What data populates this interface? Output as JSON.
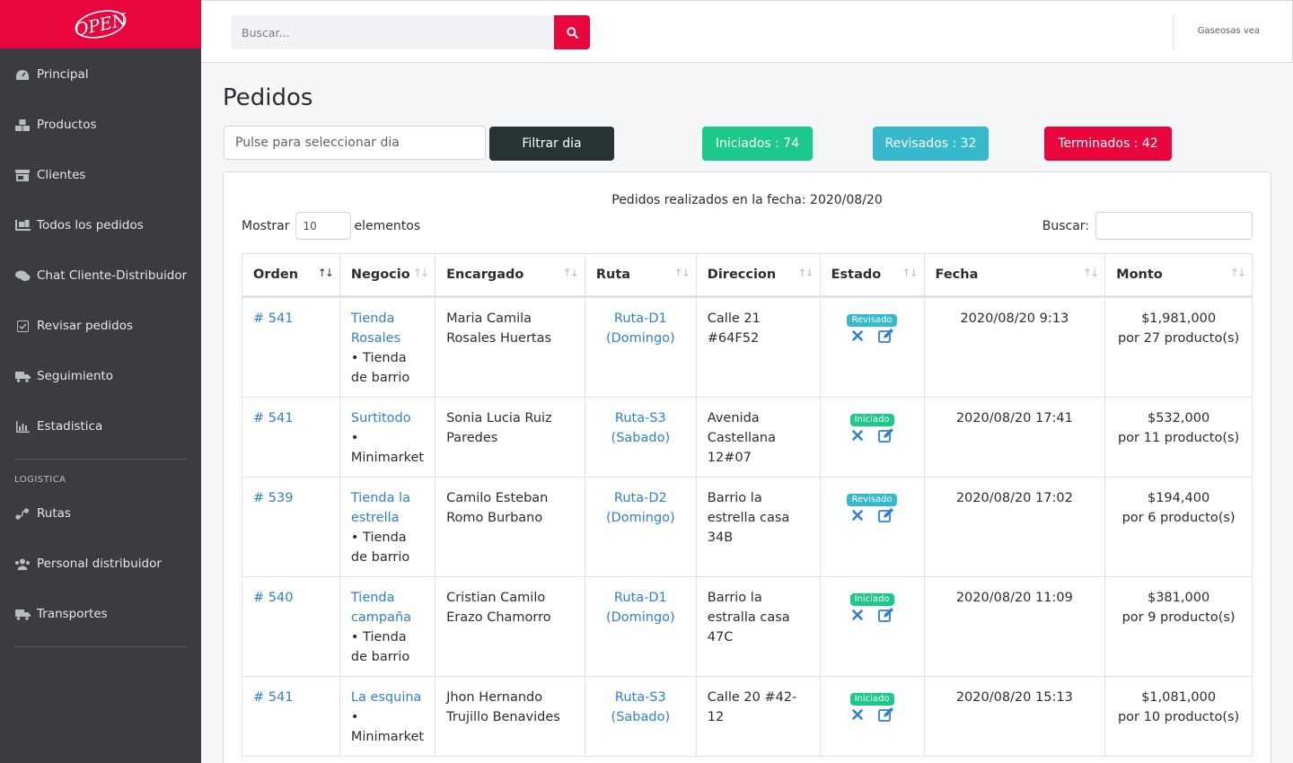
{
  "brand": {
    "logo_text": "OPEN",
    "color": "#e8063c"
  },
  "sidebar": {
    "items": [
      {
        "label": "Principal",
        "icon": "dashboard-icon"
      },
      {
        "label": "Productos",
        "icon": "boxes-icon"
      },
      {
        "label": "Clientes",
        "icon": "store-icon"
      },
      {
        "label": "Todos los pedidos",
        "icon": "dolly-icon"
      },
      {
        "label": "Chat Cliente-Distribuidor",
        "icon": "comments-icon"
      },
      {
        "label": "Revisar pedidos",
        "icon": "check-square-icon"
      },
      {
        "label": "Seguimiento",
        "icon": "truck-moving-icon"
      },
      {
        "label": "Estadistica",
        "icon": "bar-chart-icon"
      }
    ],
    "section_label": "LOGISTICA",
    "logistics_items": [
      {
        "label": "Rutas",
        "icon": "route-icon"
      },
      {
        "label": "Personal distribuidor",
        "icon": "users-icon"
      },
      {
        "label": "Transportes",
        "icon": "truck-icon"
      }
    ]
  },
  "topbar": {
    "search_placeholder": "Buscar...",
    "user_name": "Gaseosas vea"
  },
  "page": {
    "title": "Pedidos",
    "date_placeholder": "Pulse para seleccionar dia",
    "filter_label": "Filtrar dia",
    "badges": {
      "iniciados": "Iniciados :  74",
      "revisados": "Revisados : 32",
      "terminados": "Terminados : 42"
    }
  },
  "table_card": {
    "caption": "Pedidos realizados en la fecha: 2020/08/20",
    "show_label": "Mostrar",
    "show_value": "10",
    "elements_label": "elementos",
    "search_label": "Buscar:",
    "columns": [
      "Orden",
      "Negocio",
      "Encargado",
      "Ruta",
      "Direccion",
      "Estado",
      "Fecha",
      "Monto"
    ],
    "rows": [
      {
        "orden": "# 541",
        "negocio": "Tienda Rosales",
        "tipo": "• Tienda de barrio",
        "encargado": "Maria Camila Rosales Huertas",
        "ruta": "Ruta-D1 (Domingo)",
        "direccion": "Calle 21 #64F52",
        "estado": "Revisado",
        "fecha": "2020/08/20 9:13",
        "monto": "$1,981,000",
        "productos": "por 27 producto(s)"
      },
      {
        "orden": "# 541",
        "negocio": "Surtitodo",
        "tipo": "• Minimarket",
        "encargado": "Sonia Lucia Ruiz Paredes",
        "ruta": "Ruta-S3 (Sabado)",
        "direccion": "Avenida Castellana 12#07",
        "estado": "Iniciado",
        "fecha": "2020/08/20 17:41",
        "monto": "$532,000",
        "productos": "por 11 producto(s)"
      },
      {
        "orden": "# 539",
        "negocio": "Tienda la estrella",
        "tipo": "• Tienda de barrio",
        "encargado": "Camilo Esteban Romo Burbano",
        "ruta": "Ruta-D2 (Domingo)",
        "direccion": "Barrio la estrella casa 34B",
        "estado": "Revisado",
        "fecha": "2020/08/20 17:02",
        "monto": "$194,400",
        "productos": "por 6 producto(s)"
      },
      {
        "orden": "# 540",
        "negocio": "Tienda campaña",
        "tipo": "• Tienda de barrio",
        "encargado": "Cristian Camilo Erazo Chamorro",
        "ruta": "Ruta-D1 (Domingo)",
        "direccion": "Barrio la estralla casa 47C",
        "estado": "Iniciado",
        "fecha": "2020/08/20 11:09",
        "monto": "$381,000",
        "productos": "por 9 producto(s)"
      },
      {
        "orden": "# 541",
        "negocio": "La esquina",
        "tipo": "• Minimarket",
        "encargado": "Jhon Hernando Trujillo Benavides",
        "ruta": "Ruta-S3 (Sabado)",
        "direccion": "Calle 20 #42-12",
        "estado": "Iniciado",
        "fecha": "2020/08/20 15:13",
        "monto": "$1,081,000",
        "productos": "por 10 producto(s)"
      }
    ]
  },
  "colors": {
    "accent": "#e8063c",
    "sidebar": "#3a3c40",
    "success": "#1cc88a",
    "info": "#36b9cc",
    "link": "#2f7fd1",
    "dark_button": "#263436"
  }
}
